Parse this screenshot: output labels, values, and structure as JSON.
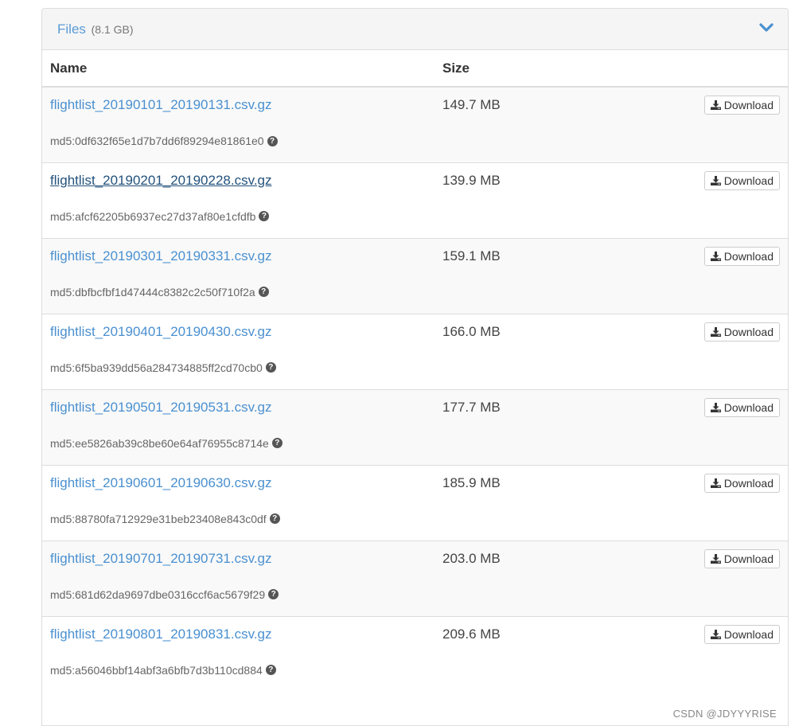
{
  "panel": {
    "title": "Files",
    "total_size": "(8.1 GB)",
    "collapse_icon": "chevron-down-icon"
  },
  "table": {
    "headers": {
      "name": "Name",
      "size": "Size"
    },
    "download_label": "Download",
    "download_icon": "download-icon",
    "help_icon": "question-circle-icon",
    "rows": [
      {
        "name": "flightlist_20190101_20190131.csv.gz",
        "md5": "md5:0df632f65e1d7b7dd6f89294e81861e0",
        "size": "149.7 MB"
      },
      {
        "name": "flightlist_20190201_20190228.csv.gz",
        "md5": "md5:afcf62205b6937ec27d37af80e1cfdfb",
        "size": "139.9 MB"
      },
      {
        "name": "flightlist_20190301_20190331.csv.gz",
        "md5": "md5:dbfbcfbf1d47444c8382c2c50f710f2a",
        "size": "159.1 MB"
      },
      {
        "name": "flightlist_20190401_20190430.csv.gz",
        "md5": "md5:6f5ba939dd56a284734885ff2cd70cb0",
        "size": "166.0 MB"
      },
      {
        "name": "flightlist_20190501_20190531.csv.gz",
        "md5": "md5:ee5826ab39c8be60e64af76955c8714e",
        "size": "177.7 MB"
      },
      {
        "name": "flightlist_20190601_20190630.csv.gz",
        "md5": "md5:88780fa712929e31beb23408e843c0df",
        "size": "185.9 MB"
      },
      {
        "name": "flightlist_20190701_20190731.csv.gz",
        "md5": "md5:681d62da9697dbe0316ccf6ac5679f29",
        "size": "203.0 MB"
      },
      {
        "name": "flightlist_20190801_20190831.csv.gz",
        "md5": "md5:a56046bbf14abf3a6bfb7d3b110cd884",
        "size": "209.6 MB"
      }
    ]
  },
  "watermark": "CSDN @JDYYYRISE"
}
